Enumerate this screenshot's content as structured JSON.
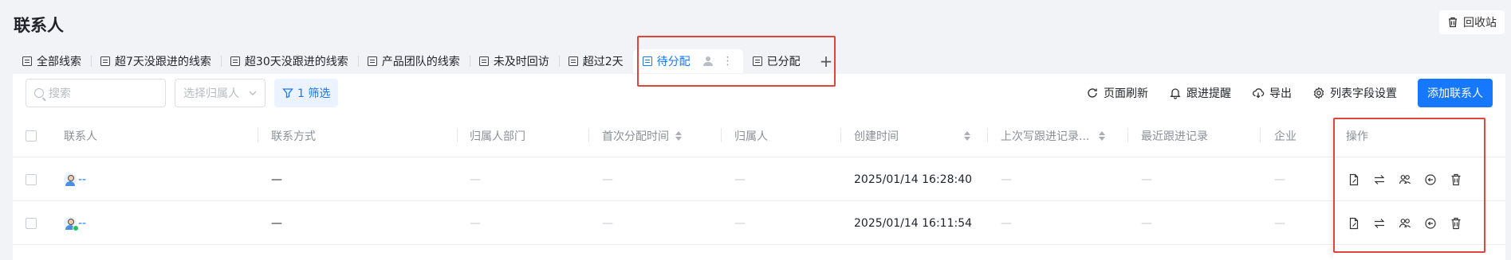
{
  "page": {
    "title": "联系人",
    "recycle_label": "回收站"
  },
  "tabs": [
    {
      "label": "全部线索"
    },
    {
      "label": "超7天没跟进的线索"
    },
    {
      "label": "超30天没跟进的线索"
    },
    {
      "label": "产品团队的线索"
    },
    {
      "label": "未及时回访"
    },
    {
      "label": "超过2天"
    },
    {
      "label": "待分配",
      "active": true
    },
    {
      "label": "已分配"
    }
  ],
  "add_tab_symbol": "+",
  "toolbar": {
    "search_placeholder": "搜索",
    "owner_select_placeholder": "选择归属人",
    "filter_label": "1 筛选",
    "refresh_label": "页面刷新",
    "reminder_label": "跟进提醒",
    "export_label": "导出",
    "column_settings_label": "列表字段设置",
    "add_contact_label": "添加联系人"
  },
  "table": {
    "headers": {
      "contact": "联系人",
      "contact_method": "联系方式",
      "owner_dept": "归属人部门",
      "first_assign_time": "首次分配时间",
      "owner": "归属人",
      "created_time": "创建时间",
      "last_followup_write": "上次写跟进记录...",
      "recent_followup": "最近跟进记录",
      "company": "企业",
      "actions": "操作"
    },
    "rows": [
      {
        "contact": "--",
        "contact_method": "—",
        "owner_dept": "—",
        "first_assign_time": "—",
        "owner": "—",
        "created_time": "2025/01/14 16:28:40",
        "last_followup_write": "—",
        "recent_followup": "—",
        "company": "—"
      },
      {
        "contact": "--",
        "contact_method": "—",
        "owner_dept": "—",
        "first_assign_time": "—",
        "owner": "—",
        "created_time": "2025/01/14 16:11:54",
        "last_followup_write": "—",
        "recent_followup": "—",
        "company": "—"
      }
    ],
    "row_action_icons": [
      "follow-up-record-icon",
      "transfer-icon",
      "assign-owner-icon",
      "return-icon",
      "delete-icon"
    ]
  },
  "colors": {
    "accent": "#1677ff",
    "highlight_box": "#e0443a",
    "wechat_badge": "#22c35e"
  }
}
